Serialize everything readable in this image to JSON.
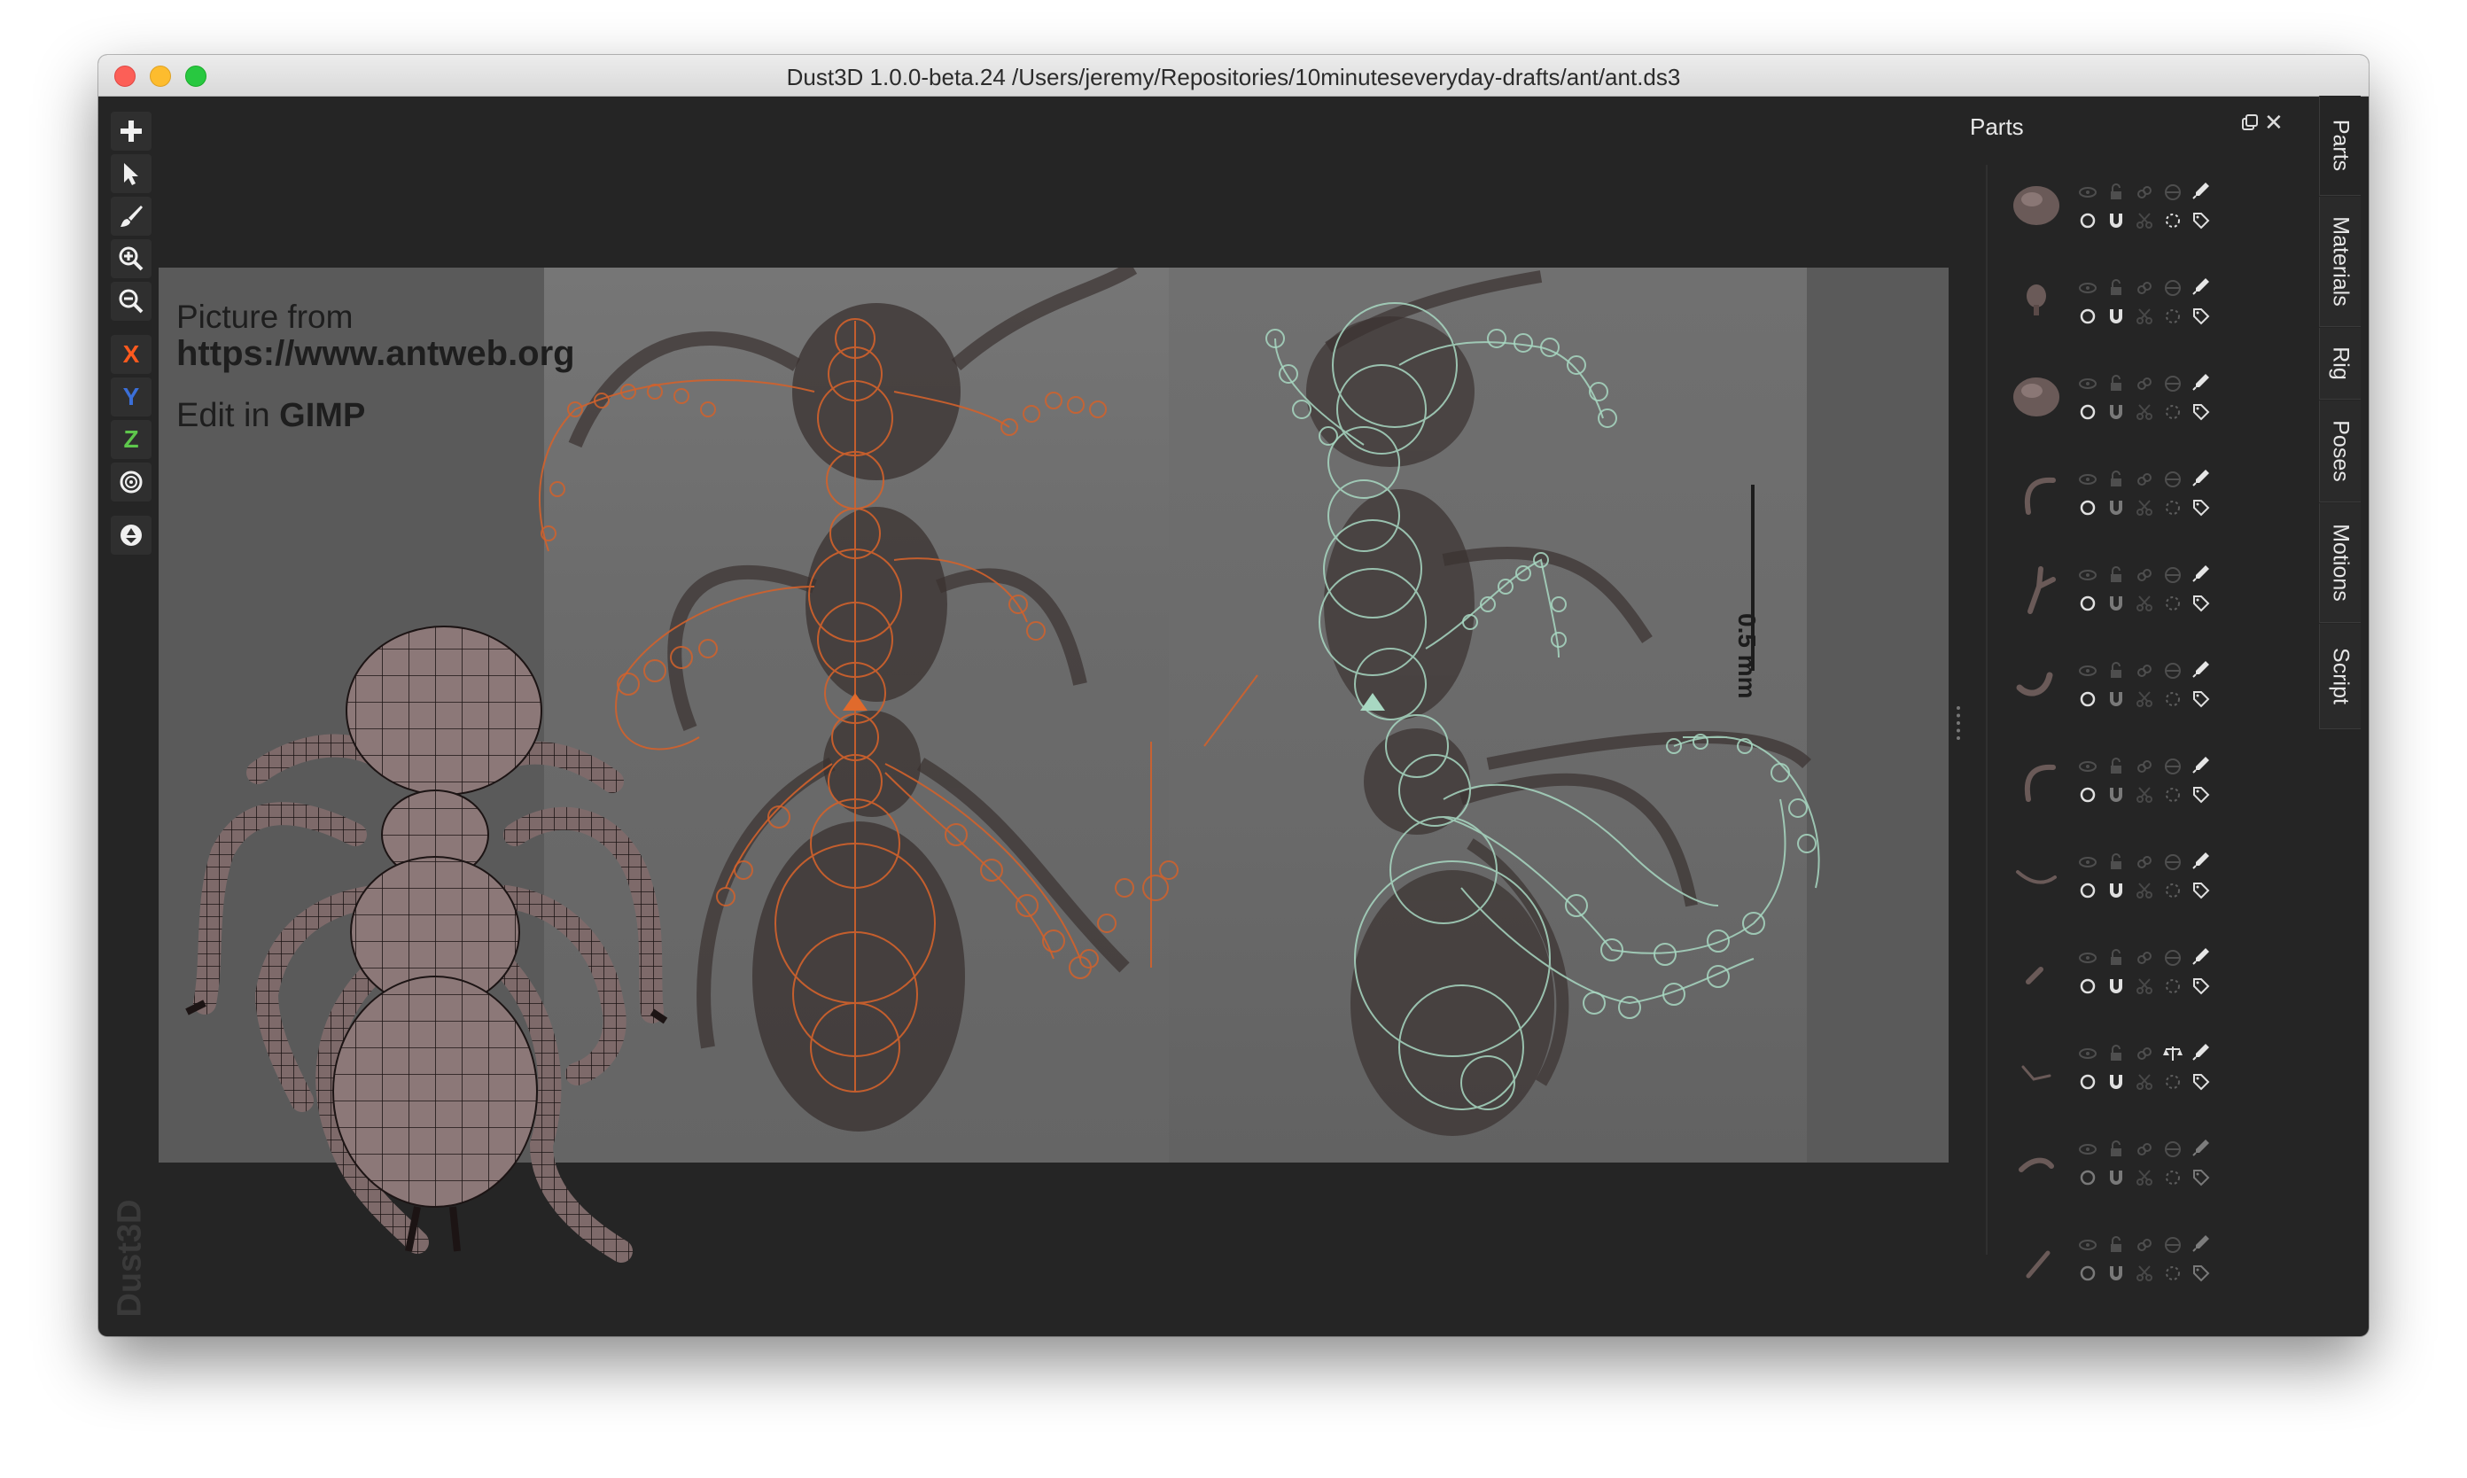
{
  "window": {
    "title": "Dust3D 1.0.0-beta.24 /Users/jeremy/Repositories/10minuteseveryday-drafts/ant/ant.ds3"
  },
  "toolbar": {
    "tools": [
      "add-icon",
      "select-icon",
      "paint-brush-icon",
      "zoom-in-icon",
      "zoom-out-icon"
    ],
    "axes": [
      {
        "label": "X",
        "color": "#ff5a1e"
      },
      {
        "label": "Y",
        "color": "#3b6fd8"
      },
      {
        "label": "Z",
        "color": "#5ec74c"
      }
    ],
    "radial_icon": "radial-mirror-icon",
    "recycle_icon": "recycle-icon"
  },
  "brand": "Dust3D",
  "viewport": {
    "credit_line1": "Picture from",
    "credit_url": "https://www.antweb.org",
    "edit_prefix": "Edit in ",
    "edit_app": "GIMP",
    "scale_label": "0.5 mm",
    "front_view_color": "#d2622c",
    "side_view_color": "#a8d8c2"
  },
  "parts_panel": {
    "title": "Parts",
    "parts": [
      {
        "shape": "blob",
        "lock": false,
        "disabled": false,
        "rotating": true,
        "dim": false
      },
      {
        "shape": "small-blob",
        "lock": false,
        "disabled": false,
        "rotating": false,
        "dim": false
      },
      {
        "shape": "blob",
        "lock": false,
        "disabled": false,
        "rotating": false,
        "dim": false
      },
      {
        "shape": "hook",
        "lock": false,
        "disabled": false,
        "rotating": false,
        "dim": false
      },
      {
        "shape": "leg",
        "lock": false,
        "disabled": false,
        "rotating": false,
        "dim": false
      },
      {
        "shape": "bent-leg",
        "lock": false,
        "disabled": false,
        "rotating": false,
        "dim": false
      },
      {
        "shape": "hook",
        "lock": false,
        "disabled": false,
        "rotating": false,
        "dim": false
      },
      {
        "shape": "antenna",
        "lock": false,
        "disabled": false,
        "rotating": false,
        "dim": false
      },
      {
        "shape": "short-leg",
        "lock": false,
        "disabled": false,
        "rotating": false,
        "dim": false
      },
      {
        "shape": "thin-leg",
        "lock": false,
        "disabled": false,
        "rotating": false,
        "dim": false,
        "balance": true
      },
      {
        "shape": "curve",
        "lock": false,
        "disabled": false,
        "rotating": false,
        "dim": true
      },
      {
        "shape": "stick",
        "lock": false,
        "disabled": false,
        "rotating": false,
        "dim": true
      }
    ]
  },
  "side_tabs": [
    "Parts",
    "Materials",
    "Rig",
    "Poses",
    "Motions",
    "Script"
  ]
}
